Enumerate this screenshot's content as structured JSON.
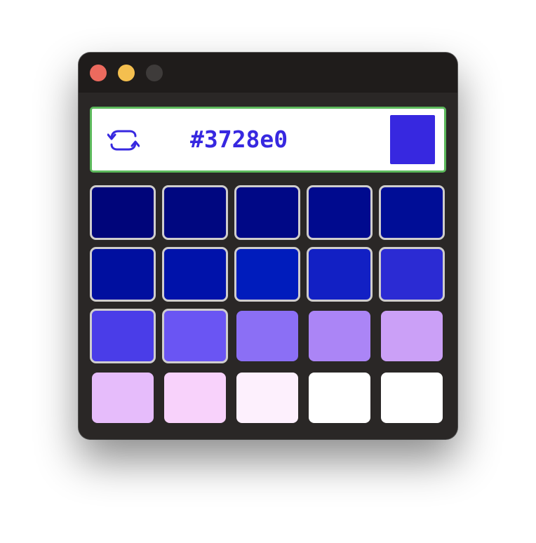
{
  "window": {
    "traffic_lights": [
      {
        "name": "close",
        "color": "#ec6a5e"
      },
      {
        "name": "minimize",
        "color": "#f4bf4f"
      },
      {
        "name": "maximize",
        "color": "#3e3b3a"
      }
    ]
  },
  "header": {
    "hex_value": "#3728e0",
    "hex_color": "#3728e0",
    "preview_color": "#3728e0",
    "refresh_icon": "refresh-icon",
    "accent_border": "#5cb85c"
  },
  "palette": {
    "rows": [
      [
        {
          "color": "#00057a",
          "selected": true
        },
        {
          "color": "#000780",
          "selected": true
        },
        {
          "color": "#000886",
          "selected": true
        },
        {
          "color": "#000a8e",
          "selected": true
        },
        {
          "color": "#000d96",
          "selected": true
        }
      ],
      [
        {
          "color": "#000f9f",
          "selected": true
        },
        {
          "color": "#0012aa",
          "selected": true
        },
        {
          "color": "#001cbc",
          "selected": true
        },
        {
          "color": "#1220c4",
          "selected": true
        },
        {
          "color": "#2b2bd3",
          "selected": true
        }
      ],
      [
        {
          "color": "#4a3de8",
          "selected": true
        },
        {
          "color": "#6a55f3",
          "selected": true
        },
        {
          "color": "#8b6ff5",
          "selected": false
        },
        {
          "color": "#ab85f6",
          "selected": false
        },
        {
          "color": "#cba0f7",
          "selected": false
        }
      ],
      [
        {
          "color": "#e6bcfb",
          "selected": false
        },
        {
          "color": "#f8d2fb",
          "selected": false
        },
        {
          "color": "#fdf0fd",
          "selected": false
        },
        {
          "color": "#ffffff",
          "selected": false
        },
        {
          "color": "#ffffff",
          "selected": false
        }
      ]
    ]
  }
}
